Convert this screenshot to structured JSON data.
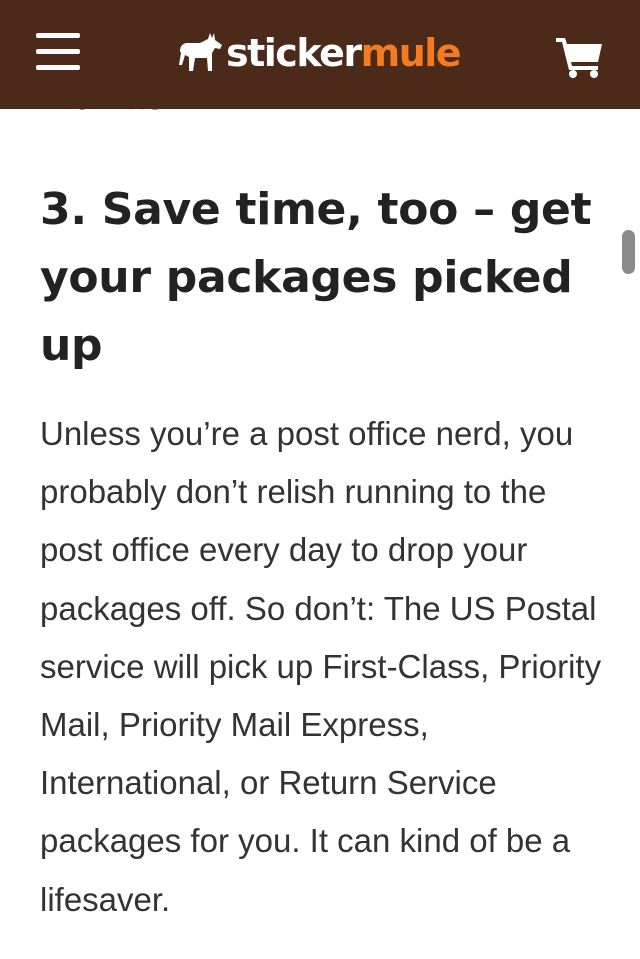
{
  "header": {
    "menu_icon": "hamburger-menu-icon",
    "logo": {
      "part1": "sticker",
      "part2": "mule",
      "icon": "mule-icon"
    },
    "cart_icon": "shopping-cart-icon",
    "bg_color": "#4b2a1a",
    "accent_color": "#f47b20"
  },
  "article": {
    "previous_paragraph_tail": "months.",
    "heading": "3. Save time, too – get your packages picked up",
    "paragraph": "Unless you’re a post office nerd, you probably don’t relish running to the post office every day to drop your packages off. So don’t: The US Postal service will pick up First-Class, Priority Mail, Priority Mail Express, International, or Return Service packages for you. It can kind of be a lifesaver."
  }
}
